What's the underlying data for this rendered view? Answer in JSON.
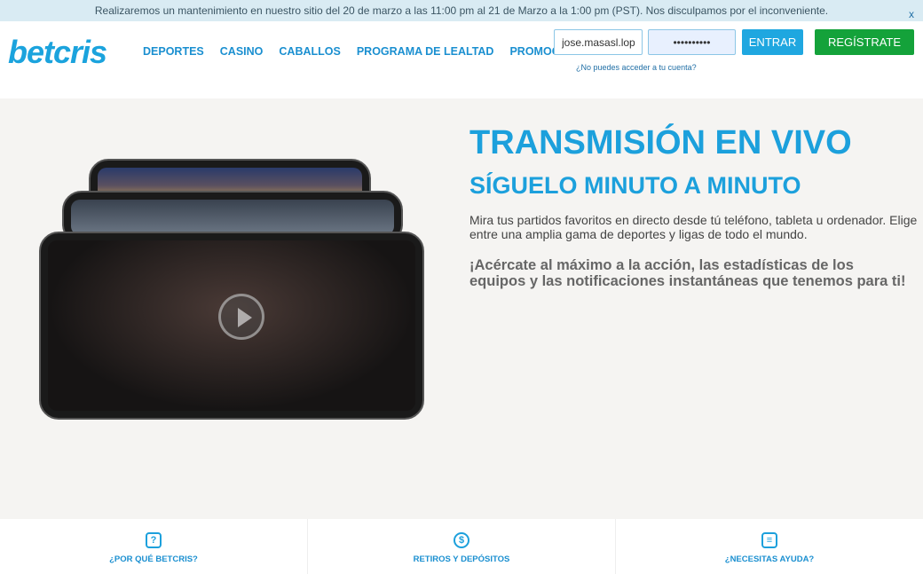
{
  "banner": {
    "text": "Realizaremos un mantenimiento en nuestro sitio del 20 de marzo a las 11:00 pm al 21 de Marzo a la 1:00 pm (PST). Nos disculpamos por el inconveniente.",
    "close": "x"
  },
  "header": {
    "logo": "betcris",
    "nav": [
      "DEPORTES",
      "CASINO",
      "CABALLOS",
      "PROGRAMA DE LEALTAD",
      "PROMOCIONES"
    ],
    "username": "jose.masasl.lop",
    "password": "••••••••••",
    "enter": "ENTRAR",
    "register": "REGÍSTRATE",
    "forgot": "¿No puedes acceder a tu cuenta?"
  },
  "hero": {
    "title": "TRANSMISIÓN EN VIVO",
    "subtitle": "SÍGUELO MINUTO A MINUTO",
    "text": "Mira tus partidos favoritos en directo desde tú teléfono, tableta u ordenador. Elige entre una amplia gama de deportes y ligas de todo el mundo.",
    "highlight": "¡Acércate al máximo a la acción, las estadísticas de los equipos y las notificaciones instantáneas que tenemos para ti!"
  },
  "footer": [
    {
      "icon": "?",
      "label": "¿POR QUÉ BETCRIS?"
    },
    {
      "icon": "$",
      "label": "RETIROS Y DEPÓSITOS"
    },
    {
      "icon": "≡",
      "label": "¿NECESITAS AYUDA?"
    }
  ],
  "colors": {
    "brand": "#1ca0dc",
    "register": "#14a23a",
    "banner": "#d9ebf3"
  }
}
